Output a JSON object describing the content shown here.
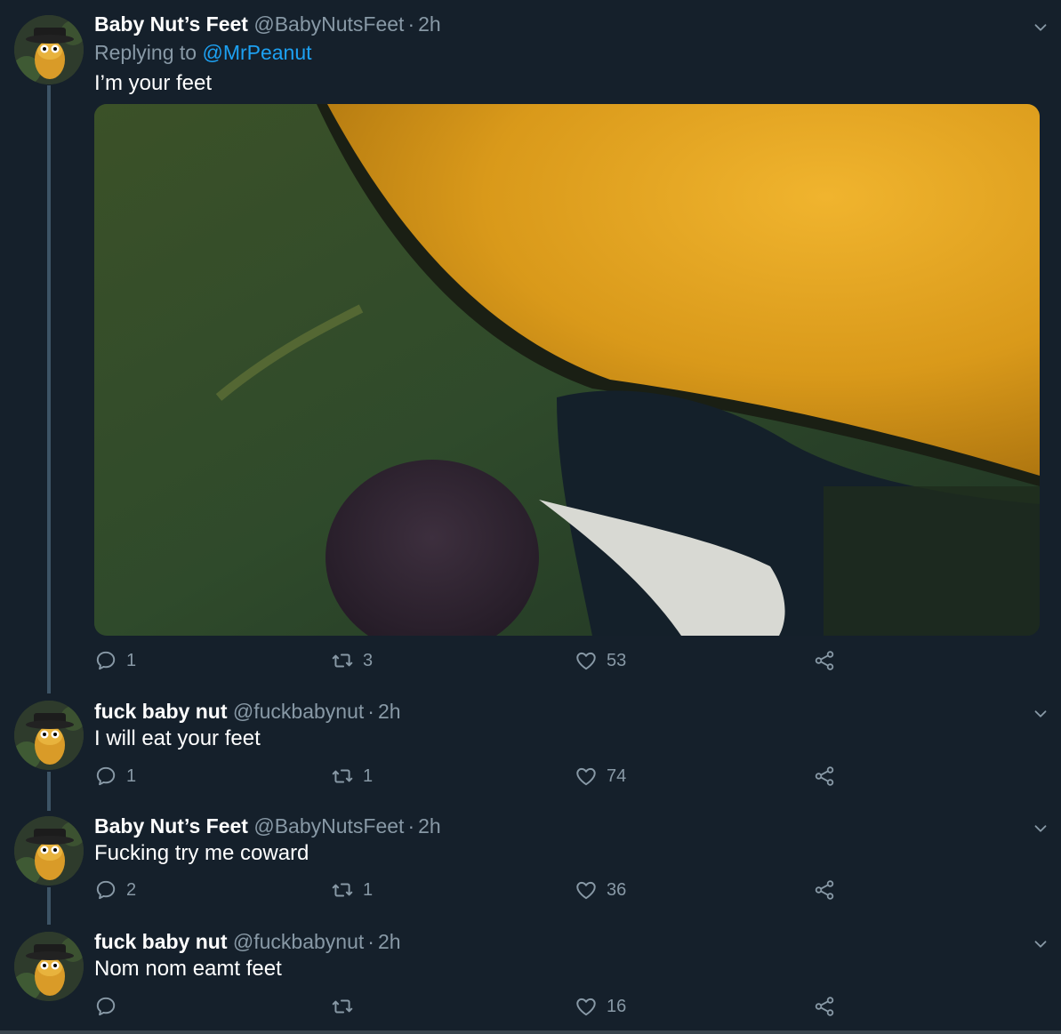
{
  "tweets": [
    {
      "name": "Baby Nut’s Feet",
      "handle": "@BabyNutsFeet",
      "time": "2h",
      "replying_label": "Replying to",
      "replying_to": "@MrPeanut",
      "text": "I’m your feet",
      "replies": "1",
      "retweets": "3",
      "likes": "53"
    },
    {
      "name": "fuck baby nut",
      "handle": "@fuckbabynut",
      "time": "2h",
      "text": "I will eat your feet",
      "replies": "1",
      "retweets": "1",
      "likes": "74"
    },
    {
      "name": "Baby Nut’s Feet",
      "handle": "@BabyNutsFeet",
      "time": "2h",
      "text": "Fucking try me coward",
      "replies": "2",
      "retweets": "1",
      "likes": "36"
    },
    {
      "name": "fuck baby nut",
      "handle": "@fuckbabynut",
      "time": "2h",
      "text": "Nom nom eamt feet",
      "replies": "",
      "retweets": "",
      "likes": "16"
    }
  ],
  "separator": "·",
  "colors": {
    "background": "#15202b",
    "secondary_text": "#8899a6",
    "link": "#1da1f2",
    "thread_line": "#3d5466"
  },
  "icons": [
    "reply-icon",
    "retweet-icon",
    "like-icon",
    "share-icon",
    "chevron-down-icon"
  ]
}
